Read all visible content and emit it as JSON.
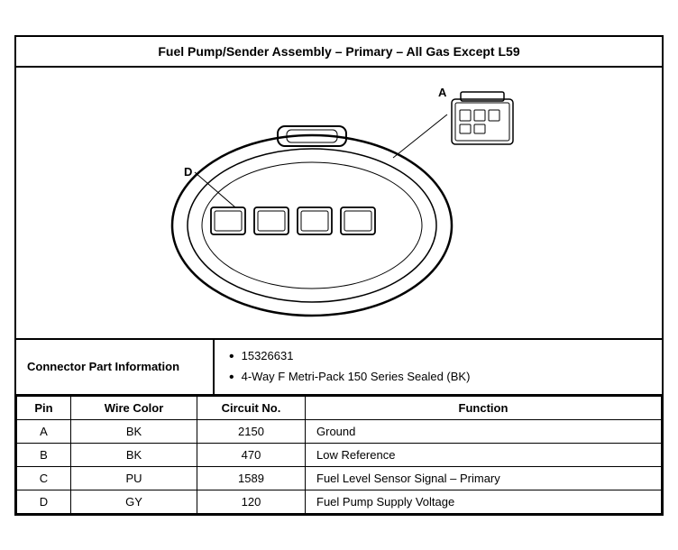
{
  "title": "Fuel Pump/Sender Assembly – Primary – All Gas Except L59",
  "connector_info": {
    "label": "Connector Part Information",
    "bullets": [
      "15326631",
      "4-Way F Metri-Pack 150 Series Sealed (BK)"
    ]
  },
  "table": {
    "headers": [
      "Pin",
      "Wire Color",
      "Circuit No.",
      "Function"
    ],
    "rows": [
      {
        "pin": "A",
        "wire_color": "BK",
        "circuit_no": "2150",
        "function": "Ground"
      },
      {
        "pin": "B",
        "wire_color": "BK",
        "circuit_no": "470",
        "function": "Low Reference"
      },
      {
        "pin": "C",
        "wire_color": "PU",
        "circuit_no": "1589",
        "function": "Fuel Level Sensor Signal – Primary"
      },
      {
        "pin": "D",
        "wire_color": "GY",
        "circuit_no": "120",
        "function": "Fuel Pump Supply Voltage"
      }
    ]
  }
}
